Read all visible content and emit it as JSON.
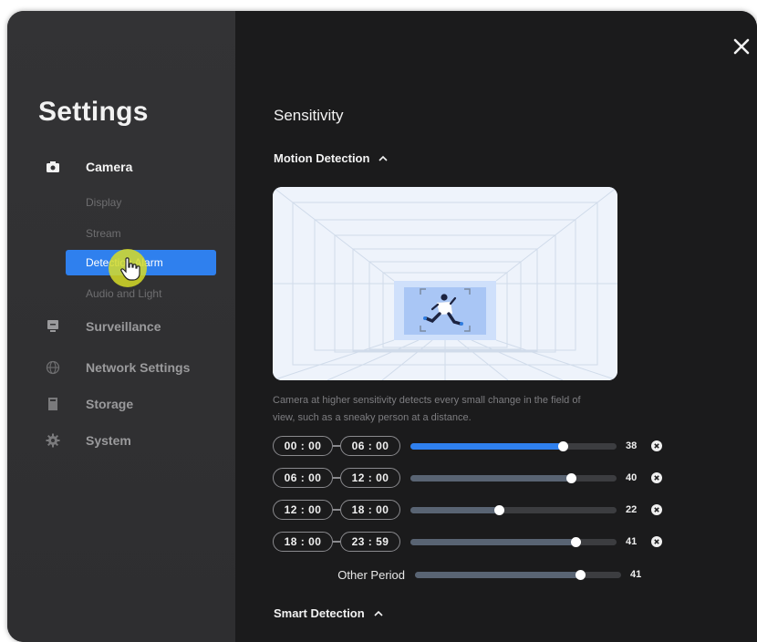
{
  "app": {
    "title": "Settings"
  },
  "sidebar": {
    "items": [
      {
        "label": "Camera",
        "icon": "camera-icon",
        "active": true
      },
      {
        "label": "Surveillance",
        "icon": "monitor-icon"
      },
      {
        "label": "Network Settings",
        "icon": "globe-icon"
      },
      {
        "label": "Storage",
        "icon": "storage-icon"
      },
      {
        "label": "System",
        "icon": "gear-icon"
      }
    ],
    "camera_subitems": [
      {
        "label": "Display"
      },
      {
        "label": "Stream"
      },
      {
        "label": "Detection Alarm",
        "active": true
      },
      {
        "label": "Audio and Light"
      }
    ]
  },
  "main": {
    "section_title": "Sensitivity",
    "motion_detection": {
      "label": "Motion Detection",
      "description_line1": "Camera at higher sensitivity detects every small change in the field of",
      "description_line2": "view, such as a sneaky person at a distance.",
      "periods": [
        {
          "start": "00 : 00",
          "end": "06 : 00",
          "value": "38",
          "fraction": 0.74,
          "highlight": true
        },
        {
          "start": "06 : 00",
          "end": "12 : 00",
          "value": "40",
          "fraction": 0.78
        },
        {
          "start": "12 : 00",
          "end": "18 : 00",
          "value": "22",
          "fraction": 0.43
        },
        {
          "start": "18 : 00",
          "end": "23 : 59",
          "value": "41",
          "fraction": 0.8
        }
      ],
      "other_period": {
        "label": "Other Period",
        "value": "41",
        "fraction": 0.8
      }
    },
    "smart_detection": {
      "label": "Smart Detection"
    }
  },
  "colors": {
    "accent": "#2f80ee",
    "window_bg": "#1b1b1c",
    "sidebar_bg": "#333335",
    "highlight_cursor": "#d6dc28"
  }
}
